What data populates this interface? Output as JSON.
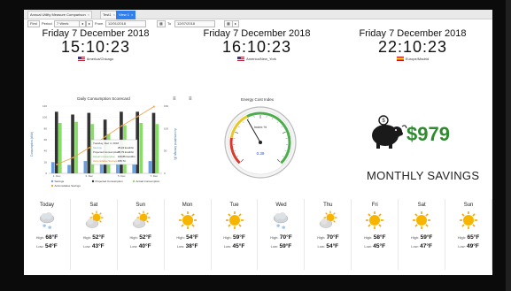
{
  "tabs": [
    {
      "label": "Annual Utility Measure Comparison",
      "active": false
    },
    {
      "label": "Test1",
      "active": false
    },
    {
      "label": "View 1",
      "active": true
    }
  ],
  "toolbar": {
    "first_label": "First",
    "period_label": "Period",
    "period_value": "7 Week",
    "from_label": "From",
    "from_value": "12/01/2018",
    "to_label": "To",
    "to_value": "12/07/2018"
  },
  "clocks": [
    {
      "date": "Friday 7 December 2018",
      "time": "15:10:23",
      "zone": "America/Chicago",
      "flag": "us"
    },
    {
      "date": "Friday 7 December 2018",
      "time": "16:10:23",
      "zone": "America/New_York",
      "flag": "us"
    },
    {
      "date": "Friday 7 December 2018",
      "time": "22:10:23",
      "zone": "Europe/Madrid",
      "flag": "es"
    }
  ],
  "scorecard": {
    "title": "Daily Consumption Scorecard",
    "y_left_label": "Consumption (kWh)",
    "y_right_label": "Accumulated Savings ($)",
    "left_ticks": [
      "120",
      "100",
      "80",
      "60",
      "40",
      "20",
      "0"
    ],
    "right_ticks": [
      "150",
      "100",
      "50",
      "0"
    ],
    "categories": [
      "1. Dec",
      "3. Dec",
      "5. Dec",
      "7. Dec"
    ],
    "legend": [
      "Savings",
      "Projected Consumption",
      "Actual Consumption",
      "Accumulative Savings"
    ],
    "tooltip": {
      "title": "Tuesday, Dec 4, 2018",
      "rows": [
        {
          "label": "Savings",
          "value": "25.24 trendrlm"
        },
        {
          "label": "Projected Consumption",
          "value": "95.79 trendrlm"
        },
        {
          "label": "Actual Consumption",
          "value": "109.85 trendrlm"
        },
        {
          "label": "Accumulative Savings",
          "value": "155.74"
        }
      ]
    },
    "colors": {
      "savings": "#6aa0e0",
      "projected": "#333333",
      "actual": "#88dd66",
      "accumulative": "#f0a040"
    }
  },
  "gauge": {
    "title": "Energy Cost Index",
    "label": "Index %",
    "value_text": "0.39",
    "value": 0.39
  },
  "savings": {
    "amount": "$979",
    "caption": "MONTHLY SAVINGS"
  },
  "forecast": {
    "high_label": "High:",
    "low_label": "Low:",
    "days": [
      {
        "name": "Today",
        "icon": "snow-cloud-icon",
        "high": "68°F",
        "low": "54°F"
      },
      {
        "name": "Sat",
        "icon": "sun-cloud-icon",
        "high": "52°F",
        "low": "43°F"
      },
      {
        "name": "Sun",
        "icon": "sun-cloud-icon",
        "high": "52°F",
        "low": "40°F"
      },
      {
        "name": "Mon",
        "icon": "sun-icon",
        "high": "54°F",
        "low": "38°F"
      },
      {
        "name": "Tue",
        "icon": "sun-icon",
        "high": "59°F",
        "low": "45°F"
      },
      {
        "name": "Wed",
        "icon": "snow-cloud-icon",
        "high": "70°F",
        "low": "59°F"
      },
      {
        "name": "Thu",
        "icon": "sun-cloud-icon",
        "high": "70°F",
        "low": "54°F"
      },
      {
        "name": "Fri",
        "icon": "sun-icon",
        "high": "58°F",
        "low": "45°F"
      },
      {
        "name": "Sat",
        "icon": "sun-icon",
        "high": "59°F",
        "low": "47°F"
      },
      {
        "name": "Sun",
        "icon": "sun-icon",
        "high": "65°F",
        "low": "49°F"
      }
    ]
  },
  "chart_data": {
    "type": "bar",
    "categories": [
      "1. Dec",
      "2. Dec",
      "3. Dec",
      "4. Dec",
      "5. Dec",
      "6. Dec",
      "7. Dec"
    ],
    "series": [
      {
        "name": "Savings",
        "values": [
          20,
          15,
          22,
          25,
          24,
          21,
          22
        ]
      },
      {
        "name": "Projected Consumption",
        "values": [
          110,
          105,
          108,
          96,
          110,
          110,
          108
        ]
      },
      {
        "name": "Actual Consumption",
        "values": [
          90,
          92,
          88,
          70,
          86,
          90,
          88
        ]
      },
      {
        "name": "Accumulative Savings",
        "values": [
          20,
          35,
          57,
          82,
          106,
          127,
          149
        ]
      }
    ],
    "title": "Daily Consumption Scorecard",
    "ylabel": "Consumption (kWh)",
    "y2label": "Accumulated Savings ($)",
    "ylim": [
      0,
      120
    ],
    "y2lim": [
      0,
      150
    ]
  }
}
